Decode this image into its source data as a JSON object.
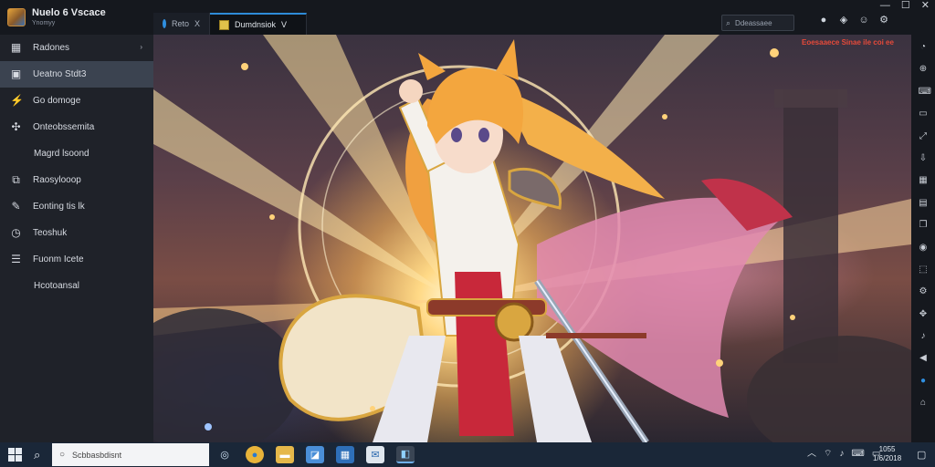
{
  "app": {
    "title": "Nuelo 6 Vscace",
    "subtitle": "Ynomyy"
  },
  "tabs": [
    {
      "label": "Reto",
      "close": "X",
      "icon": "globe-icon"
    },
    {
      "label": "Dumdnsiok",
      "close": "V",
      "icon": "app-icon"
    }
  ],
  "search": {
    "placeholder": "Ddeassaee"
  },
  "topbar_icons": [
    "user-icon",
    "shield-icon",
    "smile-icon",
    "gear-icon"
  ],
  "window_controls": {
    "minimize": "—",
    "maximize": "☐",
    "close": "✕"
  },
  "sidebar": {
    "items": [
      {
        "label": "Radones",
        "icon": "grid-icon",
        "chevron": "›"
      },
      {
        "label": "Ueatno Stdt3",
        "icon": "library-icon"
      },
      {
        "label": "Go domoge",
        "icon": "bolt-icon"
      },
      {
        "label": "Onteobssemita",
        "icon": "controller-icon"
      },
      {
        "label": "Magrd lsoond",
        "icon": ""
      },
      {
        "label": "Raosylooop",
        "icon": "store-icon"
      },
      {
        "label": "Eonting tis lk",
        "icon": "wrench-icon"
      },
      {
        "label": "Teoshuk",
        "icon": "compass-icon"
      },
      {
        "label": "Fuonm Icete",
        "icon": "list-icon"
      },
      {
        "label": "Hcotoansal",
        "icon": ""
      }
    ]
  },
  "main": {
    "notice": "Eoesaaece Sinae ile coi ee"
  },
  "rail_icons": [
    "bell-icon",
    "plus-icon",
    "keyboard-icon",
    "monitor-icon",
    "expand-icon",
    "download-icon",
    "grid-icon",
    "table-icon",
    "window-icon",
    "camera-icon",
    "capture-icon",
    "settings-icon",
    "move-icon",
    "volume-icon",
    "back-icon",
    "blue-app-icon",
    "home-icon"
  ],
  "taskbar": {
    "search_placeholder": "Scbbasbdisnt",
    "apps": [
      "cortana-icon",
      "chrome-icon",
      "folder-icon",
      "photos-icon",
      "store-icon",
      "mail-icon",
      "emulator-icon"
    ],
    "tray": [
      "chevron-up-icon",
      "network-icon",
      "volume-icon",
      "keyboard-icon",
      "chat-icon"
    ],
    "time": "1055",
    "date": "1/6/2018",
    "notification": "notification-icon"
  }
}
